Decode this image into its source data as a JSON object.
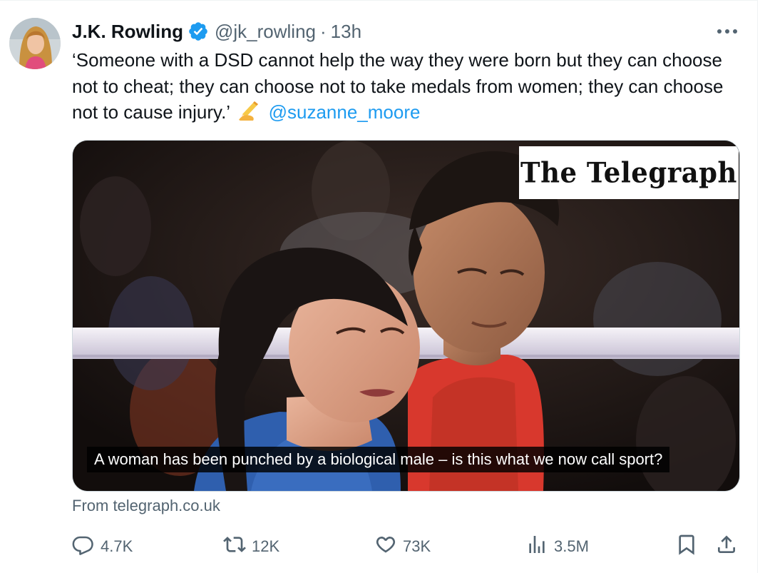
{
  "tweet": {
    "author_name": "J.K. Rowling",
    "handle": "@jk_rowling",
    "separator": "·",
    "time": "13h",
    "text": "‘Someone with a DSD cannot help the way they were born but they can choose not to cheat; they can choose not to take medals from women; they can choose not to cause injury.’",
    "mention": "@suzanne_moore"
  },
  "media": {
    "brand": "The Telegraph",
    "caption": "A woman has been punched by a biological male – is this what we now call sport?"
  },
  "source": "From telegraph.co.uk",
  "actions": {
    "replies": "4.7K",
    "reposts": "12K",
    "likes": "73K",
    "views": "3.5M"
  },
  "icons": {
    "verified": "verified-badge-icon",
    "more": "more-icon",
    "reply": "reply-icon",
    "repost": "repost-icon",
    "like": "heart-icon",
    "views": "views-icon",
    "bookmark": "bookmark-icon",
    "share": "share-icon",
    "emoji": "writing-hand-emoji"
  },
  "colors": {
    "link": "#1d9bf0",
    "verified": "#1d9bf0",
    "text": "#0f1419",
    "secondary": "#536471"
  }
}
